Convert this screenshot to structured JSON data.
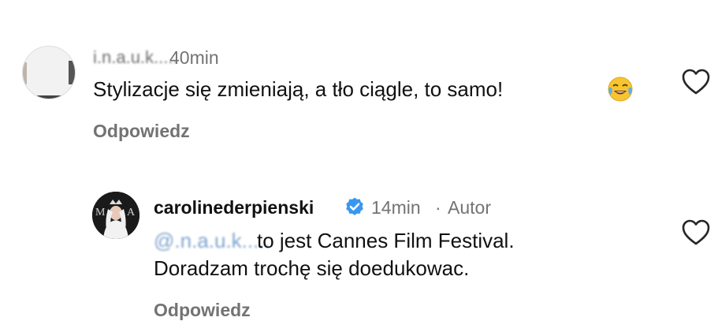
{
  "comments": [
    {
      "username_masked": "i.n.a.u.k.....",
      "time": "40min",
      "text": "Stylizacje się zmieniają, a tło ciągle, to samo!",
      "emoji": "face-with-tears-of-joy-icon",
      "reply_label": "Odpowiedz",
      "like_icon": "heart-outline-icon"
    },
    {
      "username": "carolinederpienski",
      "verified_icon": "verified-badge-icon",
      "time": "14min",
      "separator": "·",
      "author_badge": "Autor",
      "mention_masked": "@.n.a.u.k.....",
      "text_line1": "to jest Cannes Film Festival.",
      "text_line2": "Doradzam trochę się doedukowac.",
      "reply_label": "Odpowiedz",
      "like_icon": "heart-outline-icon"
    }
  ],
  "colors": {
    "text": "#111111",
    "secondary": "#737373",
    "verified": "#3897f0",
    "mention": "#4a7db8"
  }
}
